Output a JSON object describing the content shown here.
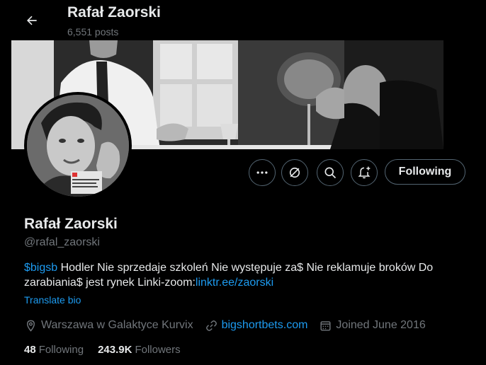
{
  "header": {
    "title": "Rafał Zaorski",
    "posts_count": "6,551 posts"
  },
  "actions": {
    "follow_label": "Following",
    "icons": [
      "more-icon",
      "grok-icon",
      "search-icon",
      "notification-plus-icon"
    ]
  },
  "profile": {
    "name": "Rafał Zaorski",
    "handle": "@rafal_zaorski",
    "bio_cashtag": "$bigsb",
    "bio_text": " Hodler Nie sprzedaje szkoleń Nie występuje za$ Nie reklamuje broków Do zarabiania$ jest rynek Linki-zoom:",
    "bio_link": "linktr.ee/zaorski",
    "translate_label": "Translate bio",
    "location": "Warszawa w Galaktyce Kurvix",
    "website": "bigshortbets.com",
    "joined": "Joined June 2016"
  },
  "stats": {
    "following_count": "48",
    "following_label": "Following",
    "followers_count": "243.9K",
    "followers_label": "Followers"
  },
  "colors": {
    "background": "#000000",
    "text": "#e7e9ea",
    "muted": "#71767b",
    "link": "#1d9bf0",
    "border": "#536471"
  }
}
